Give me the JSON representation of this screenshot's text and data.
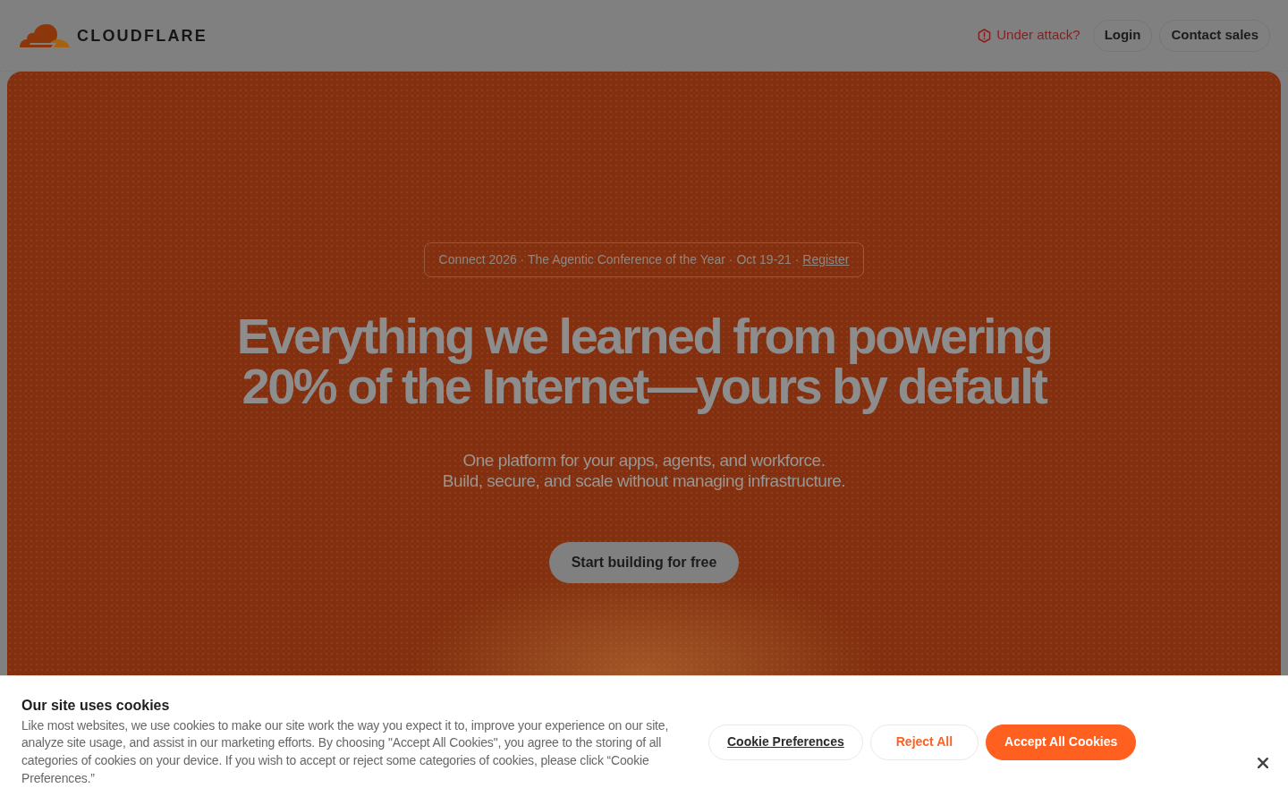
{
  "header": {
    "logo_text": "CLOUDFLARE",
    "links": [
      {
        "kind": "alert",
        "label": "Under attack?"
      },
      {
        "kind": "pill",
        "label": "Login"
      },
      {
        "kind": "pill",
        "label": "Contact sales"
      }
    ]
  },
  "hero": {
    "announcement": {
      "text": "Connect 2026 · The Agentic Conference of the Year · Oct 19-21 · ",
      "link": "Register"
    },
    "headline_lines": [
      "Everything we learned from powering",
      "20% of the Internet—yours by default"
    ],
    "subtitle_lines": [
      "One platform for your apps, agents, and workforce.",
      "Build, secure, and scale without managing infrastructure."
    ],
    "cta": "Start building for free"
  },
  "cookie_banner": {
    "title": "Our site uses cookies",
    "body": "Like most websites, we use cookies to make our site work the way you expect it to, improve your experience on our site, analyze site usage, and assist in our marketing efforts. By choosing \"Accept All Cookies\", you agree to the storing of all categories of cookies on your device. If you wish to accept or reject some categories of cookies, please click “Cookie Preferences.”",
    "buttons": [
      {
        "kind": "preferences",
        "label": "Cookie Preferences"
      },
      {
        "kind": "reject",
        "label": "Reject All"
      },
      {
        "kind": "accept",
        "label": "Accept All Cookies"
      }
    ]
  }
}
